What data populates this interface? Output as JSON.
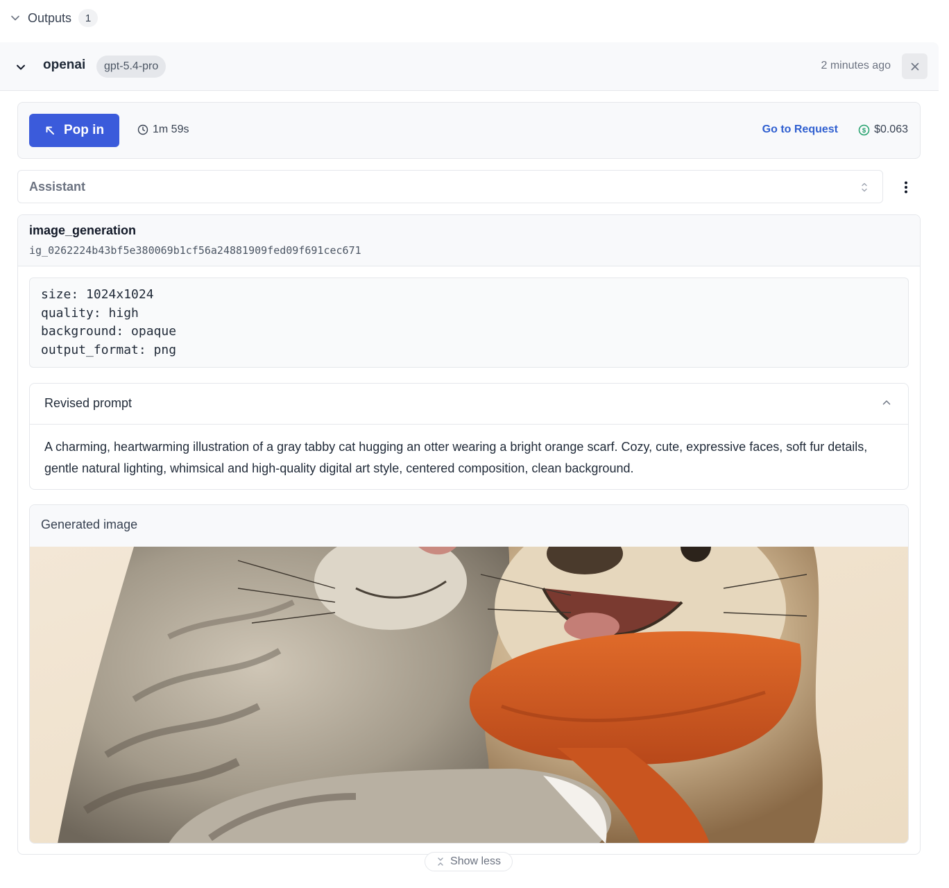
{
  "outputs": {
    "title": "Outputs",
    "count": "1"
  },
  "run": {
    "provider": "openai",
    "model": "gpt-5.4-pro",
    "time_ago": "2 minutes ago"
  },
  "toolbar": {
    "pop_in_label": "Pop in",
    "duration": "1m 59s",
    "go_to_request_label": "Go to Request",
    "cost": "$0.063",
    "accent_color": "#3b5bdb",
    "link_color": "#2f5fd0",
    "cost_icon_color": "#22a06b"
  },
  "role": {
    "selected": "Assistant"
  },
  "tool_call": {
    "name": "image_generation",
    "id": "ig_0262224b43bf5e380069b1cf56a24881909fed09f691cec671",
    "params": [
      "size: 1024x1024",
      "quality: high",
      "background: opaque",
      "output_format: png"
    ],
    "revised_prompt_title": "Revised prompt",
    "revised_prompt": "A charming, heartwarming illustration of a gray tabby cat hugging an otter wearing a bright orange scarf. Cozy, cute, expressive faces, soft fur details, gentle natural lighting, whimsical and high-quality digital art style, centered composition, clean background.",
    "generated_image_title": "Generated image"
  },
  "footer": {
    "show_less_label": "Show less"
  },
  "icons": {
    "outputs_toggle": "chevron-down-icon",
    "run_toggle": "chevron-down-icon",
    "close": "close-icon",
    "pop_in": "arrow-up-left-icon",
    "duration": "clock-icon",
    "cost": "dollar-circle-icon",
    "role_select": "chevrons-up-down-icon",
    "more": "more-vertical-icon",
    "revised_toggle": "chevron-up-icon",
    "show_less": "collapse-icon"
  }
}
